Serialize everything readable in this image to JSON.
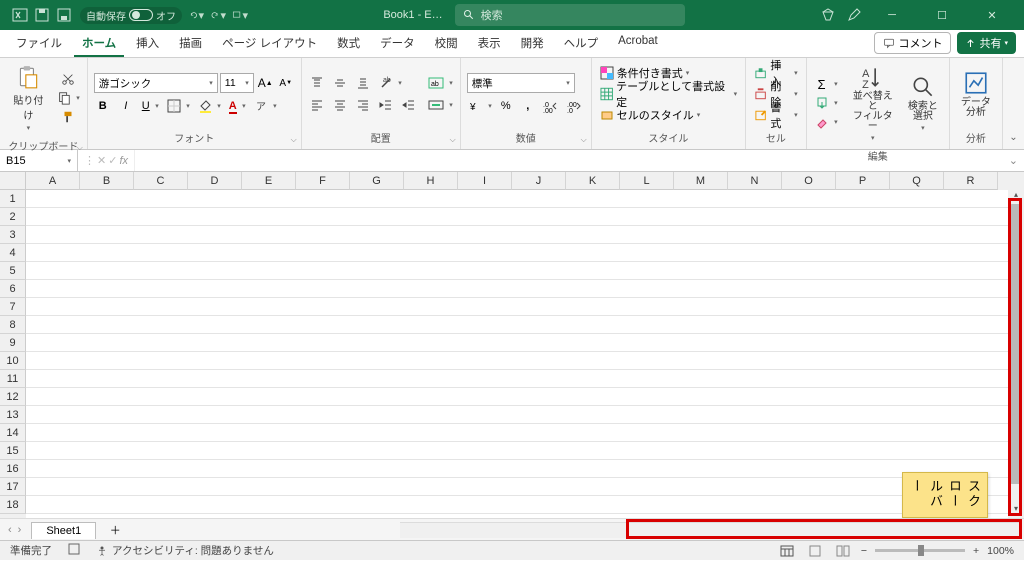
{
  "titlebar": {
    "autosave_label": "自動保存",
    "autosave_state": "オフ",
    "doc_title": "Book1 - E…",
    "search_placeholder": "検索"
  },
  "tabs": {
    "items": [
      "ファイル",
      "ホーム",
      "挿入",
      "描画",
      "ページ レイアウト",
      "数式",
      "データ",
      "校閲",
      "表示",
      "開発",
      "ヘルプ",
      "Acrobat"
    ],
    "active": "ホーム",
    "comment_label": "コメント",
    "share_label": "共有"
  },
  "ribbon": {
    "clipboard": {
      "paste": "貼り付け",
      "label": "クリップボード"
    },
    "font": {
      "name": "游ゴシック",
      "size": "11",
      "label": "フォント"
    },
    "alignment": {
      "label": "配置"
    },
    "number": {
      "format": "標準",
      "label": "数値"
    },
    "styles": {
      "cond": "条件付き書式",
      "table": "テーブルとして書式設定",
      "cell": "セルのスタイル",
      "label": "スタイル"
    },
    "cells": {
      "insert": "挿入",
      "delete": "削除",
      "format": "書式",
      "label": "セル"
    },
    "editing": {
      "sort": "並べ替えと\nフィルター",
      "find": "検索と\n選択",
      "label": "編集"
    },
    "analysis": {
      "data": "データ\n分析",
      "label": "分析"
    }
  },
  "formula_bar": {
    "cell_ref": "B15",
    "fx": "fx"
  },
  "grid": {
    "columns": [
      "A",
      "B",
      "C",
      "D",
      "E",
      "F",
      "G",
      "H",
      "I",
      "J",
      "K",
      "L",
      "M",
      "N",
      "O",
      "P",
      "Q",
      "R"
    ],
    "rows": [
      "1",
      "2",
      "3",
      "4",
      "5",
      "6",
      "7",
      "8",
      "9",
      "10",
      "11",
      "12",
      "13",
      "14",
      "15",
      "16",
      "17",
      "18"
    ]
  },
  "sheet_tabs": {
    "active": "Sheet1"
  },
  "status": {
    "ready": "準備完了",
    "accessibility": "アクセシビリティ: 問題ありません",
    "zoom": "100%"
  },
  "annotation": {
    "label": "スクロールバー"
  }
}
